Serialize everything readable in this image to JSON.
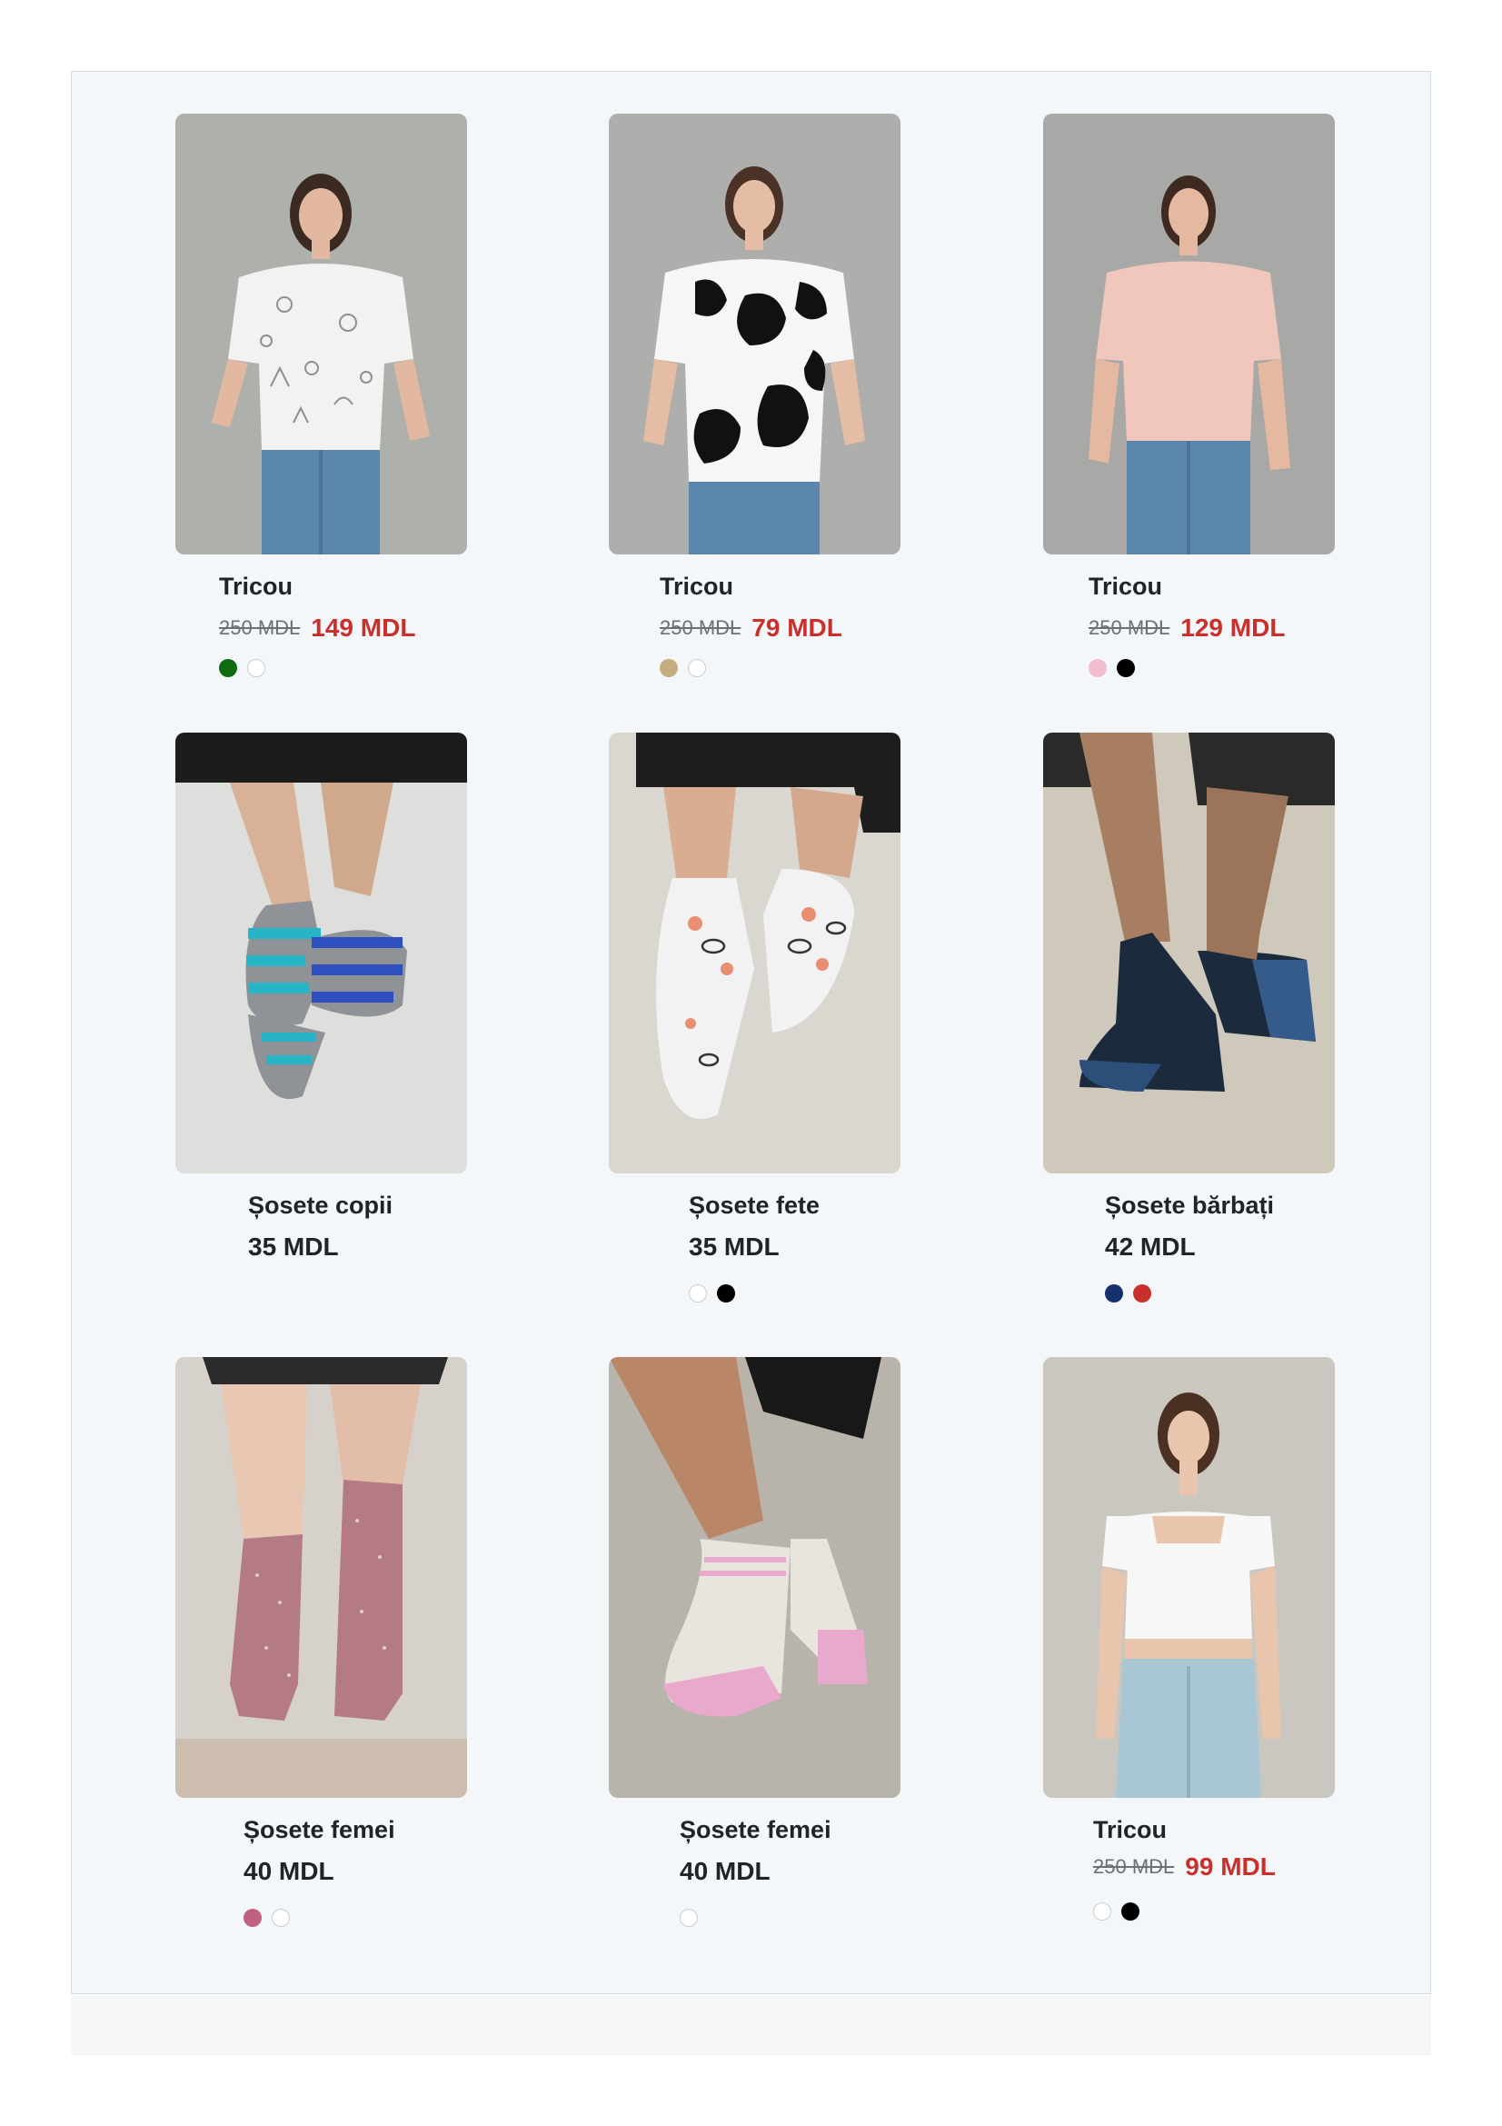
{
  "products": [
    {
      "name": "Tricou",
      "old_price": "250 MDL",
      "price": "149 MDL",
      "sale": true,
      "colors": [
        "#0f6b12",
        "#ffffff"
      ]
    },
    {
      "name": "Tricou",
      "old_price": "250 MDL",
      "price": "79 MDL",
      "sale": true,
      "colors": [
        "#c5ad80",
        "#ffffff"
      ]
    },
    {
      "name": "Tricou",
      "old_price": "250 MDL",
      "price": "129 MDL",
      "sale": true,
      "colors": [
        "#f2bcd0",
        "#000000"
      ]
    },
    {
      "name": "Șosete copii",
      "price": "35 MDL",
      "sale": false,
      "colors": []
    },
    {
      "name": "Șosete fete",
      "price": "35 MDL",
      "sale": false,
      "colors": [
        "#ffffff",
        "#000000"
      ]
    },
    {
      "name": "Șosete bărbați",
      "price": "42 MDL",
      "sale": false,
      "colors": [
        "#14306e",
        "#c9302c"
      ]
    },
    {
      "name": "Șosete femei",
      "price": "40 MDL",
      "sale": false,
      "colors": [
        "#c2607f",
        "#ffffff"
      ]
    },
    {
      "name": "Șosete femei",
      "price": "40 MDL",
      "sale": false,
      "colors": [
        "#ffffff"
      ]
    },
    {
      "name": "Tricou",
      "old_price": "250 MDL",
      "price": "99 MDL",
      "sale": true,
      "colors": [
        "#ffffff",
        "#000000"
      ]
    }
  ],
  "colors": {
    "sale_price": "#c9302c",
    "panel_background": "#f4f7f9"
  }
}
